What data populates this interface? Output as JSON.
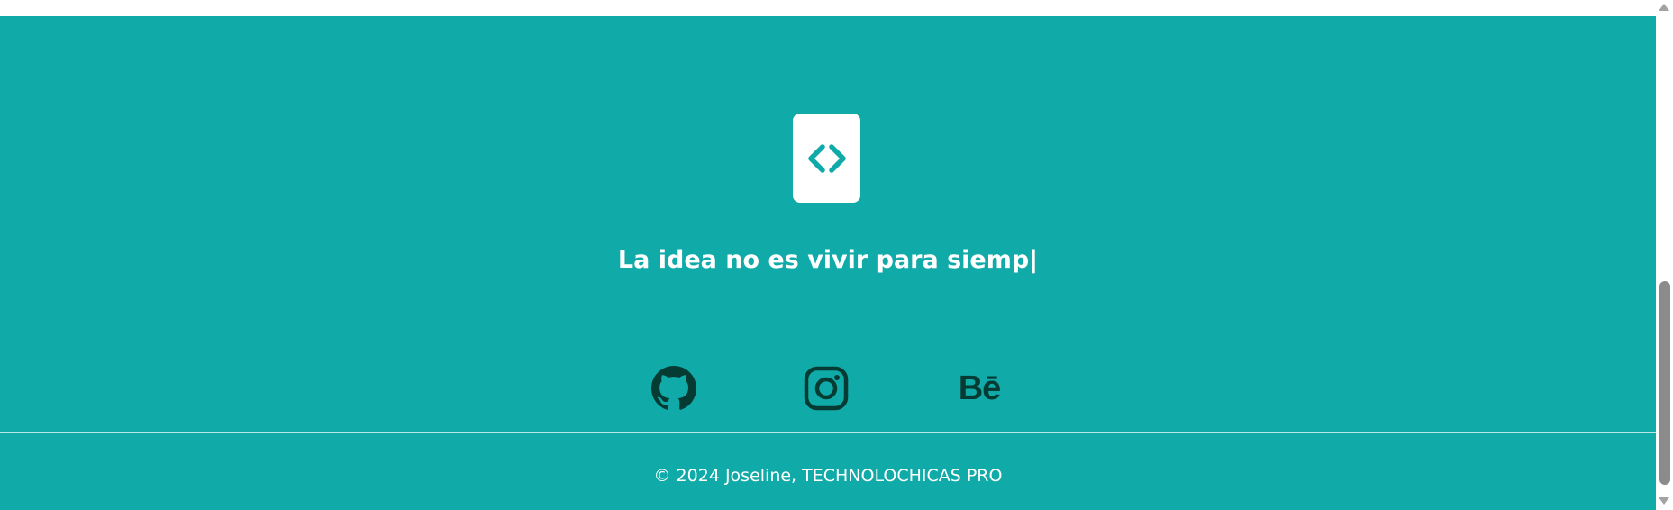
{
  "footer": {
    "background_color": "#10aaa9",
    "logo": {
      "icon": "code-brackets-icon",
      "icon_color": "#10aaa9"
    },
    "tagline": "La idea no es vivir para siemp|",
    "social": [
      {
        "icon": "github-icon"
      },
      {
        "icon": "instagram-icon"
      },
      {
        "icon": "behance-icon",
        "glyph": "Bē"
      }
    ],
    "social_icon_color": "#053b33",
    "copyright": "© 2024 Joseline, TECHNOLOCHICAS PRO"
  }
}
